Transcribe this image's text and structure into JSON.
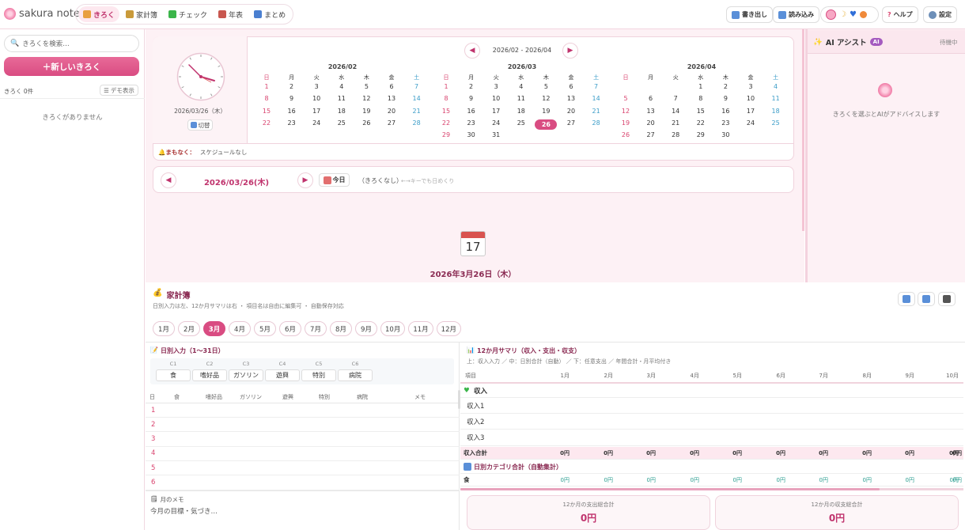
{
  "app": {
    "brand": "sakura note"
  },
  "nav": {
    "tabs": [
      {
        "label": "きろく",
        "icon": "pencil-icon",
        "active": true
      },
      {
        "label": "家計簿",
        "icon": "money-bag-icon"
      },
      {
        "label": "チェック",
        "icon": "checkmark-icon"
      },
      {
        "label": "年表",
        "icon": "calendar-icon"
      },
      {
        "label": "まとめ",
        "icon": "bar-chart-icon"
      }
    ]
  },
  "toolbar": {
    "export": "書き出し",
    "import": "読み込み",
    "help": "ヘルプ",
    "settings": "設定"
  },
  "sidebar": {
    "search_placeholder": "きろくを検索…",
    "new_button": "＋新しいきろく",
    "count": "きろく 0件",
    "demo": "デモ表示",
    "empty": "きろくがありません"
  },
  "clock": {
    "date": "2026/03/26（木）",
    "toggle": "切替"
  },
  "calendar": {
    "range": "2026/02 - 2026/04",
    "weekdays": [
      "日",
      "月",
      "火",
      "水",
      "木",
      "金",
      "土"
    ],
    "months": [
      {
        "title": "2026/02",
        "start": 0,
        "days": 28
      },
      {
        "title": "2026/03",
        "start": 0,
        "days": 31,
        "today": 26
      },
      {
        "title": "2026/04",
        "start": 3,
        "days": 30
      }
    ],
    "upcoming_label": "まもなく：",
    "upcoming_text": "スケジュールなし"
  },
  "datebar": {
    "date": "2026/03/26(木)",
    "today": "今日",
    "status": "（きろくなし）",
    "hint": "←→キーでも日めくり"
  },
  "day": {
    "icon_num": "17",
    "title": "2026年3月26日（木）"
  },
  "ai": {
    "title": "AI アシスト",
    "badge": "AI",
    "status": "待機中",
    "message": "きろくを選ぶとAIがアドバイスします"
  },
  "kakeibo": {
    "title": "家計簿",
    "subtitle": "日別入力は左、12か月サマリは右 ・ 項目名は自由に編集可 ・ 自動保存対応",
    "months": [
      "1月",
      "2月",
      "3月",
      "4月",
      "5月",
      "6月",
      "7月",
      "8月",
      "9月",
      "10月",
      "11月",
      "12月"
    ],
    "active_month": 2,
    "daily_title": "日別入力（1〜31日）",
    "cats": [
      {
        "code": "C1",
        "name": "食"
      },
      {
        "code": "C2",
        "name": "嗜好品"
      },
      {
        "code": "C3",
        "name": "ガソリン"
      },
      {
        "code": "C4",
        "name": "遊興"
      },
      {
        "code": "C5",
        "name": "特別"
      },
      {
        "code": "C6",
        "name": "病院"
      }
    ],
    "table_head": [
      "日",
      "食",
      "嗜好品",
      "ガソリン",
      "遊興",
      "特別",
      "病院",
      "メモ"
    ],
    "days": [
      "1",
      "2",
      "3",
      "4",
      "5",
      "6"
    ],
    "memo_title": "月のメモ",
    "memo_placeholder": "今月の目標・気づき…",
    "summary_title": "12か月サマリ（収入・支出・収支）",
    "summary_sub": "上：収入入力 ／ 中：日別合計（自動） ／ 下：任意支出 ／ 年間合計・月平均付き",
    "summary_cols": [
      "項目",
      "1月",
      "2月",
      "3月",
      "4月",
      "5月",
      "6月",
      "7月",
      "8月",
      "9月",
      "10月"
    ],
    "income_label": "収入",
    "income_rows": [
      "収入1",
      "収入2",
      "収入3"
    ],
    "income_total": "収入合計",
    "zero": "0円",
    "cat_total_title": "日別カテゴリ合計（自動集計）",
    "cat_first": "食",
    "total_expense_label": "12か月の支出総合計",
    "total_balance_label": "12か月の収支総合計",
    "total_expense": "0円",
    "total_balance": "0円"
  }
}
